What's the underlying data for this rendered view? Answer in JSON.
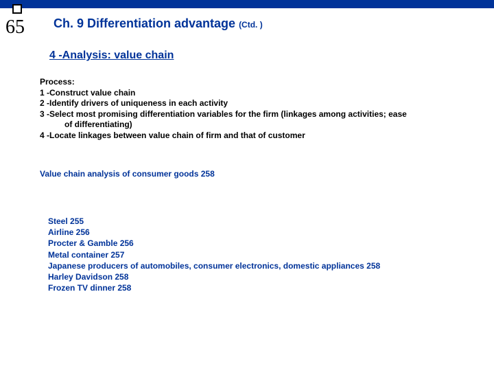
{
  "pageNumber": "65",
  "title": "Ch. 9 Differentiation advantage",
  "titleSuffix": "(Ctd. )",
  "section": "4 -Analysis: value chain",
  "process": {
    "heading": "Process:",
    "item1": "1 -Construct value chain",
    "item2": "2 -Identify drivers of uniqueness in each activity",
    "item3a": "3 -Select most promising differentiation variables for the firm (linkages among activities; ease",
    "item3b": "of differentiating)",
    "item4": "4 -Locate linkages between value chain of firm and that of customer"
  },
  "consumer": "Value chain analysis of consumer goods 258",
  "examples": {
    "e1": "Steel 255",
    "e2": "Airline 256",
    "e3": "Procter & Gamble 256",
    "e4": "Metal container  257",
    "e5": "Japanese producers of automobiles, consumer electronics, domestic appliances 258",
    "e6": "Harley Davidson 258",
    "e7": "Frozen TV dinner 258"
  }
}
